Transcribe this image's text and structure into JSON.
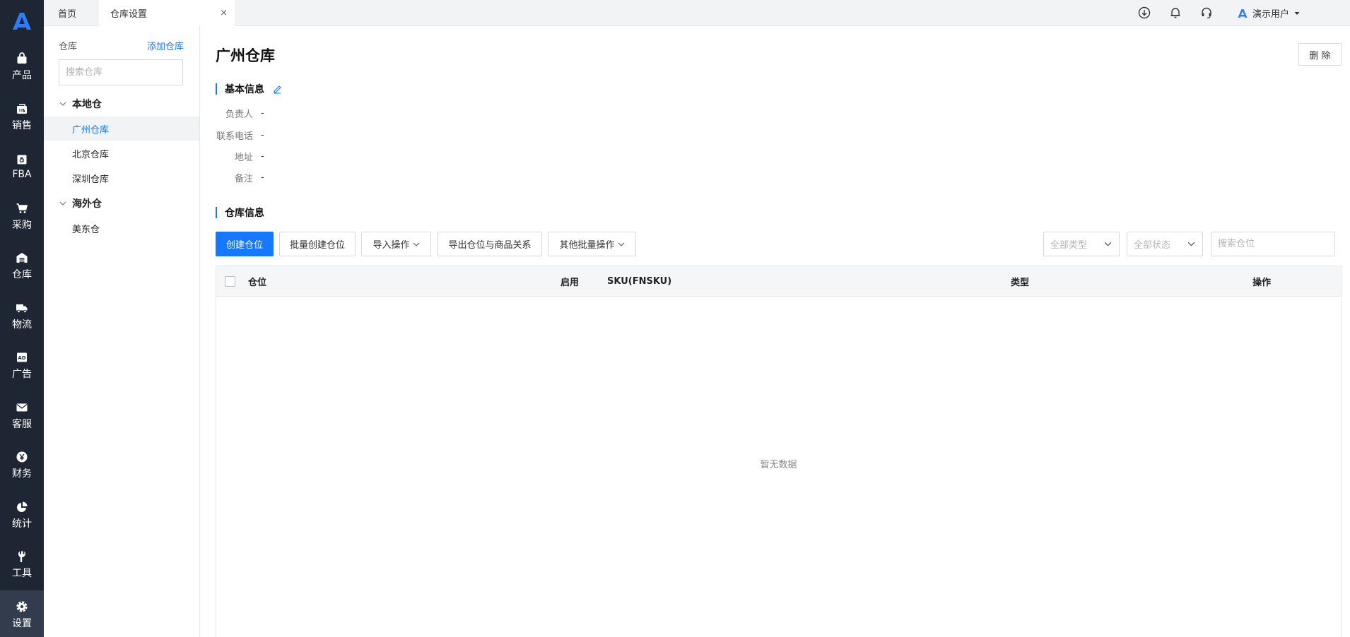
{
  "nav": {
    "items": [
      {
        "label": "产品",
        "icon": "bag-icon"
      },
      {
        "label": "销售",
        "icon": "sell-icon"
      },
      {
        "label": "FBA",
        "icon": "amazon-icon"
      },
      {
        "label": "采购",
        "icon": "cart-icon"
      },
      {
        "label": "仓库",
        "icon": "warehouse-icon"
      },
      {
        "label": "物流",
        "icon": "truck-icon"
      },
      {
        "label": "广告",
        "icon": "ad-icon"
      },
      {
        "label": "客服",
        "icon": "mail-icon"
      },
      {
        "label": "财务",
        "icon": "yen-icon"
      },
      {
        "label": "统计",
        "icon": "pie-chart-icon"
      },
      {
        "label": "工具",
        "icon": "wrench-icon"
      },
      {
        "label": "设置",
        "icon": "gear-icon"
      }
    ],
    "active_index": 11
  },
  "tabs": {
    "home": "首页",
    "active": "仓库设置",
    "close": "×"
  },
  "topbar": {
    "user_name": "演示用户"
  },
  "sidebar": {
    "title": "仓库",
    "add_label": "添加仓库",
    "search_placeholder": "搜索仓库",
    "groups": [
      {
        "label": "本地仓",
        "items": [
          "广州仓库",
          "北京仓库",
          "深圳仓库"
        ]
      },
      {
        "label": "海外仓",
        "items": [
          "美东仓"
        ]
      }
    ]
  },
  "main": {
    "title": "广州仓库",
    "delete_label": "删 除",
    "basic_info": {
      "title": "基本信息",
      "fields": [
        {
          "label": "负责人",
          "value": "-"
        },
        {
          "label": "联系电话",
          "value": "-"
        },
        {
          "label": "地址",
          "value": "-"
        },
        {
          "label": "备注",
          "value": "-"
        }
      ]
    },
    "warehouse_info": {
      "title": "仓库信息",
      "buttons": {
        "create": "创建仓位",
        "batch_create": "批量创建仓位",
        "import": "导入操作",
        "export": "导出仓位与商品关系",
        "other_batch": "其他批量操作"
      },
      "filters": {
        "type": "全部类型",
        "status": "全部状态",
        "search_placeholder": "搜索仓位"
      },
      "table": {
        "columns": [
          "仓位",
          "启用",
          "SKU(FNSKU)",
          "类型",
          "操作"
        ],
        "empty_text": "暂无数据"
      }
    }
  },
  "colors": {
    "primary": "#1677ff",
    "nav_bg": "#1f2633"
  }
}
